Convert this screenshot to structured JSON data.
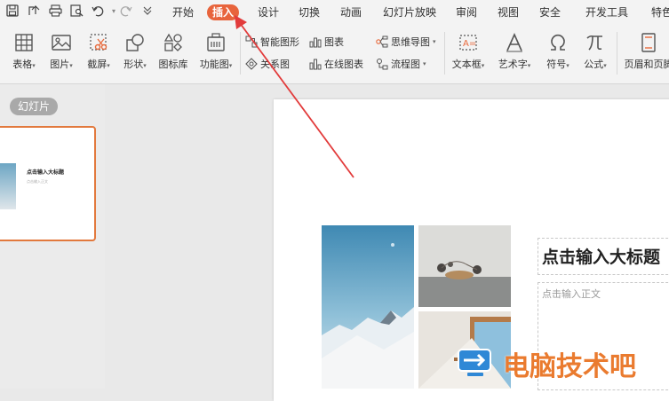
{
  "menu": {
    "items": [
      "开始",
      "插入",
      "设计",
      "切换",
      "动画",
      "幻灯片放映",
      "审阅",
      "视图",
      "安全",
      "开发工具",
      "特色"
    ],
    "active": "插入"
  },
  "ribbon": {
    "table": "表格",
    "picture": "图片",
    "screenshot": "截屏",
    "shapes": "形状",
    "icon_library": "图标库",
    "function_chart": "功能图",
    "smartart": "智能图形",
    "chart": "图表",
    "mindmap": "思维导图",
    "relation": "关系图",
    "online_chart": "在线图表",
    "flowchart": "流程图",
    "textbox": "文本框",
    "wordart": "艺术字",
    "symbol": "符号",
    "formula": "公式",
    "header_footer": "页眉和页脚"
  },
  "left_panel": {
    "tab": "幻灯片",
    "thumb_title": "点击输入大标题",
    "thumb_body": "点击输入正文"
  },
  "slide": {
    "title_placeholder": "点击输入大标题",
    "body_placeholder": "点击输入正文"
  },
  "watermark": "电脑技术吧",
  "colors": {
    "accent": "#e8643c",
    "annotation_arrow": "#e23b3b",
    "thumb_border": "#e2793d"
  }
}
